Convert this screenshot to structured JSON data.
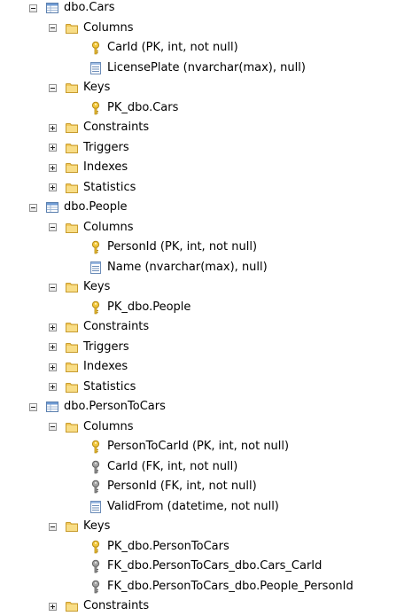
{
  "tree": {
    "nodes": [
      {
        "label": "dbo.Cars",
        "kind": "table",
        "expander": "minus",
        "level": 0
      },
      {
        "label": "Columns",
        "kind": "folder",
        "expander": "minus",
        "level": 1
      },
      {
        "label": "CarId (PK, int, not null)",
        "kind": "key-gold",
        "expander": "none",
        "level": 2
      },
      {
        "label": "LicensePlate (nvarchar(max), null)",
        "kind": "column",
        "expander": "none",
        "level": 2
      },
      {
        "label": "Keys",
        "kind": "folder",
        "expander": "minus",
        "level": 1
      },
      {
        "label": "PK_dbo.Cars",
        "kind": "key-gold",
        "expander": "none",
        "level": 2
      },
      {
        "label": "Constraints",
        "kind": "folder",
        "expander": "plus",
        "level": 1
      },
      {
        "label": "Triggers",
        "kind": "folder",
        "expander": "plus",
        "level": 1
      },
      {
        "label": "Indexes",
        "kind": "folder",
        "expander": "plus",
        "level": 1
      },
      {
        "label": "Statistics",
        "kind": "folder",
        "expander": "plus",
        "level": 1
      },
      {
        "label": "dbo.People",
        "kind": "table",
        "expander": "minus",
        "level": 0
      },
      {
        "label": "Columns",
        "kind": "folder",
        "expander": "minus",
        "level": 1
      },
      {
        "label": "PersonId (PK, int, not null)",
        "kind": "key-gold",
        "expander": "none",
        "level": 2
      },
      {
        "label": "Name (nvarchar(max), null)",
        "kind": "column",
        "expander": "none",
        "level": 2
      },
      {
        "label": "Keys",
        "kind": "folder",
        "expander": "minus",
        "level": 1
      },
      {
        "label": "PK_dbo.People",
        "kind": "key-gold",
        "expander": "none",
        "level": 2
      },
      {
        "label": "Constraints",
        "kind": "folder",
        "expander": "plus",
        "level": 1
      },
      {
        "label": "Triggers",
        "kind": "folder",
        "expander": "plus",
        "level": 1
      },
      {
        "label": "Indexes",
        "kind": "folder",
        "expander": "plus",
        "level": 1
      },
      {
        "label": "Statistics",
        "kind": "folder",
        "expander": "plus",
        "level": 1
      },
      {
        "label": "dbo.PersonToCars",
        "kind": "table",
        "expander": "minus",
        "level": 0
      },
      {
        "label": "Columns",
        "kind": "folder",
        "expander": "minus",
        "level": 1
      },
      {
        "label": "PersonToCarId (PK, int, not null)",
        "kind": "key-gold",
        "expander": "none",
        "level": 2
      },
      {
        "label": "CarId (FK, int, not null)",
        "kind": "key-gray",
        "expander": "none",
        "level": 2
      },
      {
        "label": "PersonId (FK, int, not null)",
        "kind": "key-gray",
        "expander": "none",
        "level": 2
      },
      {
        "label": "ValidFrom (datetime, not null)",
        "kind": "column",
        "expander": "none",
        "level": 2
      },
      {
        "label": "Keys",
        "kind": "folder",
        "expander": "minus",
        "level": 1
      },
      {
        "label": "PK_dbo.PersonToCars",
        "kind": "key-gold",
        "expander": "none",
        "level": 2
      },
      {
        "label": "FK_dbo.PersonToCars_dbo.Cars_CarId",
        "kind": "key-gray",
        "expander": "none",
        "level": 2
      },
      {
        "label": "FK_dbo.PersonToCars_dbo.People_PersonId",
        "kind": "key-gray",
        "expander": "none",
        "level": 2
      },
      {
        "label": "Constraints",
        "kind": "folder",
        "expander": "plus",
        "level": 1
      }
    ]
  },
  "icon_names": {
    "table": "table-icon",
    "folder": "folder-icon",
    "key-gold": "primary-key-icon",
    "key-gray": "foreign-key-icon",
    "column": "column-icon"
  },
  "colors": {
    "folder_fill": "#f7d774",
    "folder_edge": "#c9a43a",
    "key_gold": "#e2b42c",
    "key_gray": "#8a8a8a",
    "table_blue": "#4a7fc0"
  }
}
